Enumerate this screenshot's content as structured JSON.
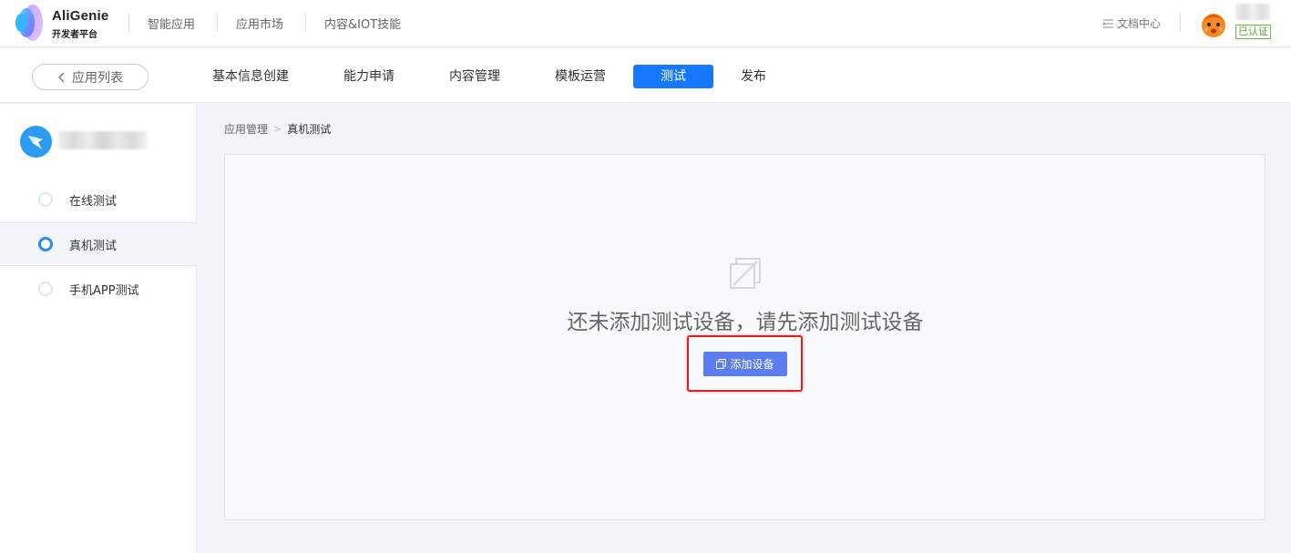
{
  "header": {
    "logo_title": "AliGenie",
    "logo_subtitle": "开发者平台",
    "nav": [
      "智能应用",
      "应用市场",
      "内容&IOT技能"
    ],
    "doc_link": "文档中心",
    "verified_badge": "已认证"
  },
  "subnav": {
    "back_label": "应用列表",
    "tabs": [
      "基本信息创建",
      "能力申请",
      "内容管理",
      "模板运营",
      "测试",
      "发布"
    ],
    "active_tab": "测试"
  },
  "sidebar": {
    "items": [
      {
        "label": "在线测试",
        "active": false
      },
      {
        "label": "真机测试",
        "active": true
      },
      {
        "label": "手机APP测试",
        "active": false
      }
    ]
  },
  "breadcrumb": {
    "parent": "应用管理",
    "current": "真机测试"
  },
  "empty_state": {
    "message": "还未添加测试设备，请先添加测试设备",
    "button_label": "添加设备"
  },
  "colors": {
    "primary": "#1677ff",
    "button": "#5b7df0",
    "highlight": "#e02020",
    "verified": "#52a63a"
  }
}
